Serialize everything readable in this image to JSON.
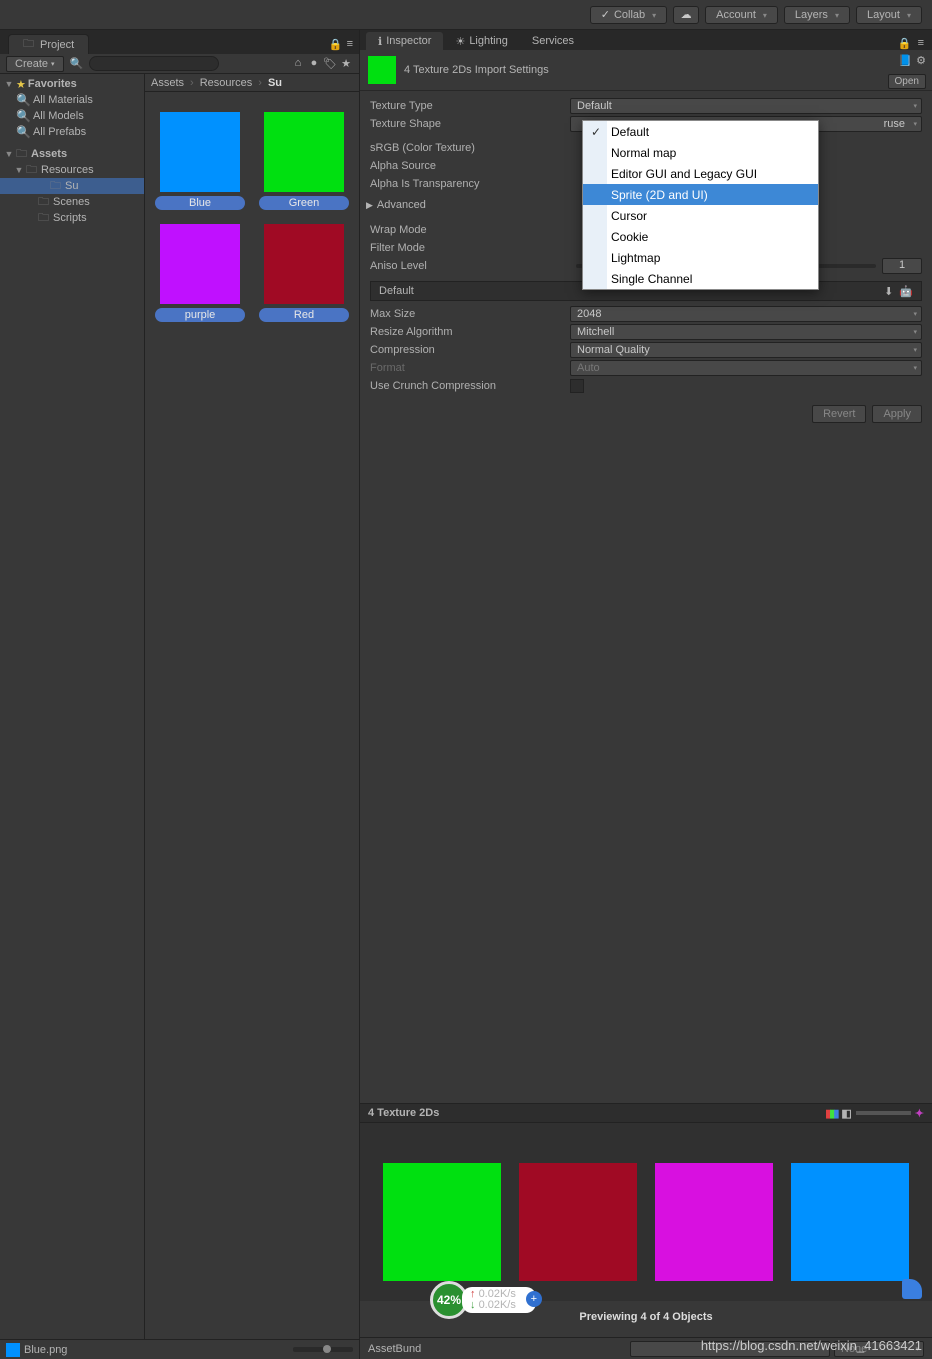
{
  "toolbar": {
    "collab": "Collab",
    "account": "Account",
    "layers": "Layers",
    "layout": "Layout"
  },
  "project": {
    "tab": "Project",
    "create": "Create",
    "favorites": "Favorites",
    "fav_items": [
      "All Materials",
      "All Models",
      "All Prefabs"
    ],
    "assets": "Assets",
    "tree": [
      "Resources",
      "Su",
      "Scenes",
      "Scripts"
    ],
    "breadcrumb": [
      "Assets",
      "Resources",
      "Su"
    ],
    "thumbs": [
      {
        "name": "Blue",
        "color": "#0091ff"
      },
      {
        "name": "Green",
        "color": "#00e010"
      },
      {
        "name": "purple",
        "color": "#c010ff"
      },
      {
        "name": "Red",
        "color": "#a00a24"
      }
    ],
    "status_file": "Blue.png"
  },
  "inspector": {
    "tabs": {
      "inspector": "Inspector",
      "lighting": "Lighting",
      "services": "Services"
    },
    "title": "4 Texture 2Ds Import Settings",
    "open": "Open",
    "props": {
      "texture_type": "Texture Type",
      "texture_type_val": "Default",
      "texture_shape": "Texture Shape",
      "texture_shape_val": "ruse",
      "srgb": "sRGB (Color Texture)",
      "alpha_source": "Alpha Source",
      "alpha_trans": "Alpha Is Transparency",
      "advanced": "Advanced",
      "wrap": "Wrap Mode",
      "filter": "Filter Mode",
      "aniso": "Aniso Level",
      "aniso_val": "1",
      "default_tab": "Default",
      "max_size": "Max Size",
      "max_size_val": "2048",
      "resize": "Resize Algorithm",
      "resize_val": "Mitchell",
      "compression": "Compression",
      "compression_val": "Normal Quality",
      "format": "Format",
      "format_val": "Auto",
      "crunch": "Use Crunch Compression"
    },
    "revert": "Revert",
    "apply": "Apply"
  },
  "dropdown": {
    "options": [
      "Default",
      "Normal map",
      "Editor GUI and Legacy GUI",
      "Sprite (2D and UI)",
      "Cursor",
      "Cookie",
      "Lightmap",
      "Single Channel"
    ],
    "checked": 0,
    "highlighted": 3
  },
  "preview": {
    "title": "4 Texture 2Ds",
    "colors": [
      "#00e010",
      "#a00a24",
      "#d810e0",
      "#0091ff"
    ],
    "caption": "Previewing 4 of 4 Objects",
    "assetbundle": "AssetBund",
    "none": "None"
  },
  "badge": {
    "pct": "42%",
    "up": "0.02K/s",
    "down": "0.02K/s"
  },
  "watermark": "https://blog.csdn.net/weixin_41663421"
}
